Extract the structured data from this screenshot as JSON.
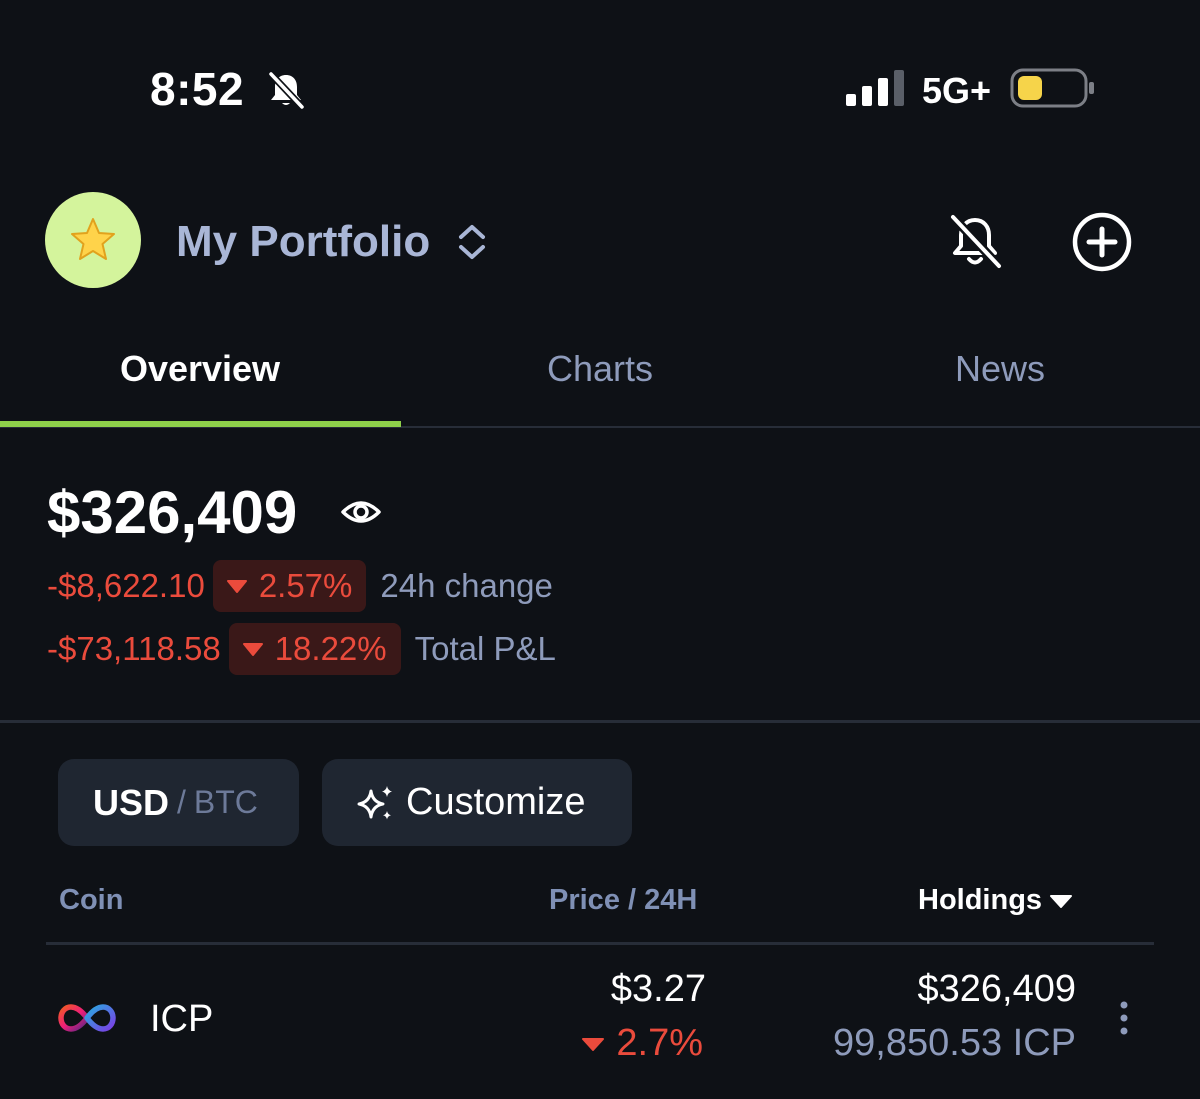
{
  "status_bar": {
    "time": "8:52",
    "network": "5G+"
  },
  "header": {
    "portfolio_title": "My Portfolio",
    "avatar_icon": "star-emoji",
    "accent_color": "#d4f49c"
  },
  "tabs": [
    {
      "label": "Overview",
      "active": true
    },
    {
      "label": "Charts",
      "active": false
    },
    {
      "label": "News",
      "active": false
    }
  ],
  "summary": {
    "balance": "$326,409",
    "change_24h": {
      "value": "-$8,622.10",
      "percent": "2.57%",
      "label": "24h change"
    },
    "total_pnl": {
      "value": "-$73,118.58",
      "percent": "18.22%",
      "label": "Total P&L"
    },
    "negative_color": "#ea4b3c"
  },
  "controls": {
    "currency_primary": "USD",
    "currency_separator": "/",
    "currency_secondary": "BTC",
    "customize_label": "Customize"
  },
  "table": {
    "headers": {
      "coin": "Coin",
      "price": "Price / 24H",
      "holdings": "Holdings"
    },
    "rows": [
      {
        "symbol": "ICP",
        "price": "$3.27",
        "change": "2.7%",
        "holding_value": "$326,409",
        "holding_amount": "99,850.53 ICP"
      }
    ]
  }
}
